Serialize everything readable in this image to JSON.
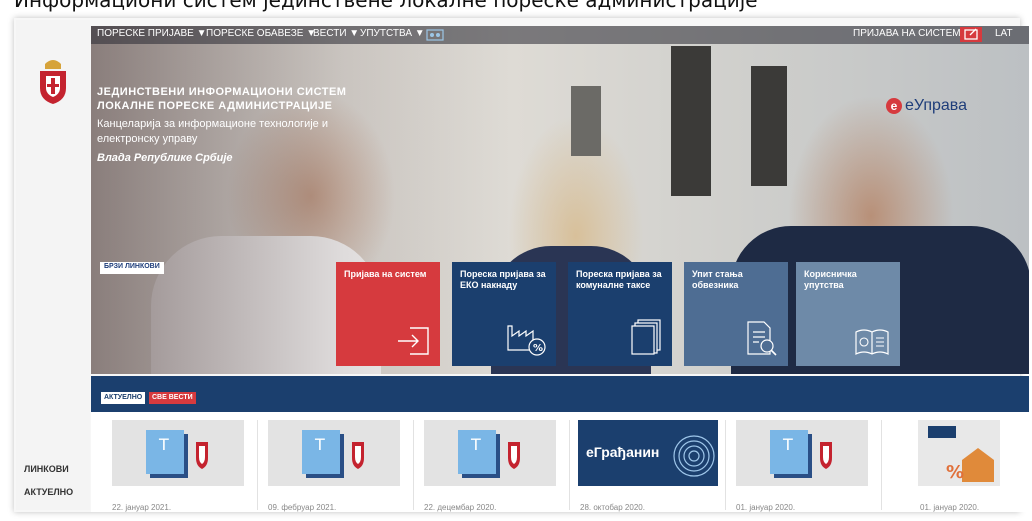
{
  "caption": "Информациони систем јединствене локалне пореске администрације",
  "topbar": {
    "nav": [
      "ПОРЕСКЕ ПРИЈАВЕ ▼",
      "ПОРЕСКЕ ОБАВЕЗЕ ▼",
      "ВЕСТИ ▼",
      "УПУТСТВА ▼"
    ],
    "login": "ПРИЈАВА НА СИСТЕМ",
    "lang": "LAT"
  },
  "hero": {
    "title_line1": "ЈЕДИНСТВЕНИ ИНФОРМАЦИОНИ СИСТЕМ",
    "title_line2": "ЛОКАЛНЕ ПОРЕСКЕ АДМИНИСТРАЦИЈЕ",
    "subtitle_line1": "Канцеларија за информационе технологије и",
    "subtitle_line2": "електронску управу",
    "gov": "Влада Републике Србије",
    "eup_logo": "еУправа"
  },
  "quick": {
    "label": "БРЗИ ЛИНКОВИ",
    "tiles": [
      {
        "label_line1": "Пријава на систем",
        "label_line2": "",
        "color": "#d63a3e"
      },
      {
        "label_line1": "Пореска пријава за",
        "label_line2": "ЕКО накнаду",
        "color": "#1b3f6e"
      },
      {
        "label_line1": "Пореска пријава за",
        "label_line2": "комуналне таксе",
        "color": "#1b3f6e"
      },
      {
        "label_line1": "Упит стања",
        "label_line2": "обвезника",
        "color": "#4e6d93"
      },
      {
        "label_line1": "Корисничка",
        "label_line2": "упутства",
        "color": "#6e8aa8"
      }
    ]
  },
  "news": {
    "tabs": [
      "АКТУЕЛНО",
      "СВЕ ВЕСТИ"
    ],
    "egradjanin": "еГрађанин",
    "dates": [
      "22. јануар 2021.",
      "09. фебруар 2021.",
      "22. децембар 2020.",
      "28. октобар 2020.",
      "01. јануар 2020.",
      "01. јануар 2020."
    ]
  },
  "sidebar": {
    "links": [
      "ЛИНКОВИ",
      "АКТУЕЛНО"
    ]
  }
}
